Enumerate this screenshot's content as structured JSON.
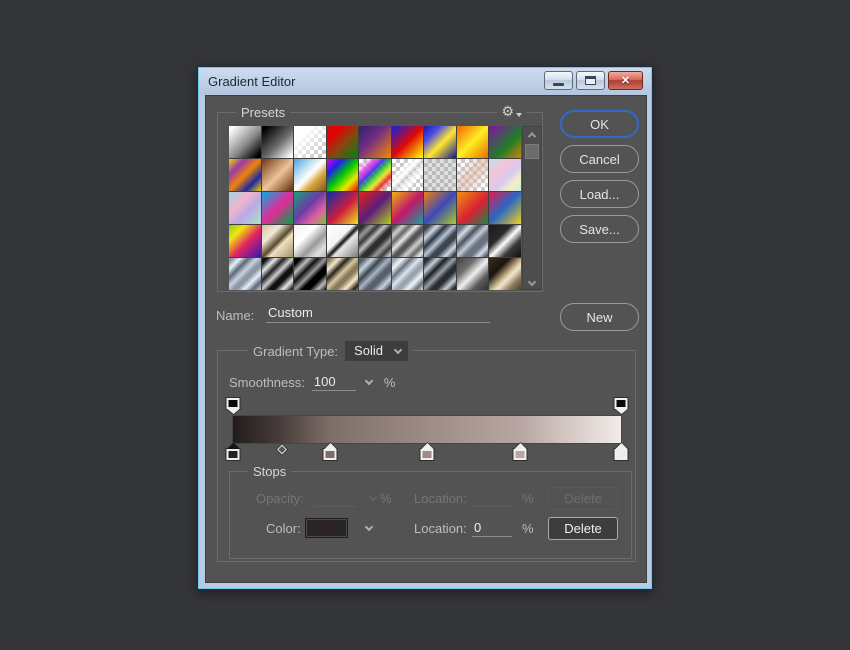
{
  "window": {
    "title": "Gradient Editor"
  },
  "buttons": {
    "ok": "OK",
    "cancel": "Cancel",
    "load": "Load...",
    "save": "Save...",
    "new": "New"
  },
  "presets": {
    "legend": "Presets",
    "menu_icon": "⚙",
    "tiles": [
      {
        "name": "white-to-black",
        "css": "linear-gradient(135deg,#ffffff 8%,#8a8a8a 55%,#000000 92%)"
      },
      {
        "name": "black-to-white",
        "css": "linear-gradient(135deg,#000000 8%,#6a6a6a 55%,#ffffff 95%)"
      },
      {
        "name": "white-to-transparent",
        "css": "linear-gradient(135deg,#ffffff 25%,rgba(255,255,255,0) 85%),conic-gradient(#c9c9c9 25%,#ffffff 25% 50%,#c9c9c9 50% 75%,#ffffff 75%) 0 0/8px 8px"
      },
      {
        "name": "red-to-green",
        "css": "linear-gradient(135deg,#dd0404 25%,#8a4510 55%,#137a10 92%)"
      },
      {
        "name": "violet-to-orange",
        "css": "linear-gradient(135deg,#38276e 8%,#6f2a85 40%,#ea830b 95%)"
      },
      {
        "name": "blue-red-yellow",
        "css": "linear-gradient(135deg,#2222cc 5%,#e00606 50%,#ffee00 95%)"
      },
      {
        "name": "blue-yellow-blue",
        "css": "linear-gradient(135deg,#1a1aa8 0%,#4a4ae8 25%,#ffe92b 55%,#14149a 100%)"
      },
      {
        "name": "orange-yellow-orange",
        "css": "linear-gradient(135deg,#f57905 8%,#ffee22 50%,#ee7702 95%)"
      },
      {
        "name": "purple-green-orange",
        "css": "linear-gradient(135deg,#7a1b9a 5%,#1e7d26 60%,#e8820a 105%)"
      },
      {
        "name": "yellow-violet-orange-blue",
        "css": "linear-gradient(135deg,#f5d402 0%,#9a3aaa 25%,#ef8209 50%,#1c2aa0 75%,#f5d402 100%)"
      },
      {
        "name": "copper",
        "css": "linear-gradient(135deg,#7a4420 5%,#eec498 52%,#6e3c1c 95%)"
      },
      {
        "name": "chrome-blue-gold",
        "css": "linear-gradient(135deg,#4aa2e0 0%,#cfe6f5 35%,#ffffff 50%,#d8a93e 68%,#7a551a 100%)"
      },
      {
        "name": "spectrum",
        "css": "linear-gradient(135deg,#e402e4 0%,#2020e8 25%,#02c802 50%,#e8e802 75%,#e80202 100%)"
      },
      {
        "name": "transparent-rainbow",
        "css": "linear-gradient(135deg,rgba(255,255,255,0) 12%,rgba(230,40,230,0.85) 28%,rgba(40,40,230,0.85) 40%,rgba(30,200,30,0.85) 52%,rgba(235,235,30,0.85) 64%,rgba(235,30,30,0.85) 76%,rgba(255,255,255,0) 90%),conic-gradient(#c9c9c9 25%,#ffffff 25% 50%,#c9c9c9 50% 75%,#ffffff 75%) 0 0/8px 8px"
      },
      {
        "name": "transparent-stripes",
        "css": "linear-gradient(135deg,rgba(255,255,255,0) 25%,rgba(255,255,255,0.95) 42%,rgba(180,180,180,0.4) 55%,rgba(255,255,255,0.8) 63%,rgba(255,255,255,0) 78%),conic-gradient(#c9c9c9 25%,#ffffff 25% 50%,#c9c9c9 50% 75%,#ffffff 75%) 0 0/8px 8px"
      },
      {
        "name": "transparent",
        "css": "linear-gradient(135deg,rgba(150,150,150,0.3),rgba(150,150,150,0.3)),conic-gradient(#c9c9c9 25%,#ffffff 25% 50%,#c9c9c9 50% 75%,#ffffff 75%) 0 0/8px 8px"
      },
      {
        "name": "transparent-rose",
        "css": "linear-gradient(135deg,rgba(255,255,255,0) 15%,rgba(219,173,160,0.6) 50%,rgba(255,255,255,0.1) 85%),conic-gradient(#c9c9c9 25%,#ffffff 25% 50%,#c9c9c9 50% 75%,#ffffff 75%) 0 0/8px 8px"
      },
      {
        "name": "pastel-soft",
        "css": "linear-gradient(135deg,#bfe3ef 0%,#f3c4d6 32%,#d9c9ef 58%,#f5efc9 78%,#c9efd9 100%)"
      },
      {
        "name": "pastel-rainbow",
        "css": "linear-gradient(135deg,#9fd4ea 0%,#f0b4cc 35%,#b9a9e6 60%,#abe6c4 100%)"
      },
      {
        "name": "cyan-magenta-green",
        "css": "linear-gradient(135deg,#19a2d8 5%,#e42a9a 50%,#13984a 95%)"
      },
      {
        "name": "teal-purple-pink-green",
        "css": "linear-gradient(135deg,#16a17e 0%,#6d3ba4 45%,#e060a8 72%,#7fc22f 100%)"
      },
      {
        "name": "blue-red-yellow-2",
        "css": "linear-gradient(135deg,#1c2ba3 5%,#cf1f3e 55%,#efe71c 100%)"
      },
      {
        "name": "red-violet-lime",
        "css": "linear-gradient(135deg,#d92121 5%,#5c1d79 50%,#b2cf1d 100%)"
      },
      {
        "name": "gold-magenta-teal",
        "css": "linear-gradient(135deg,#efb211 0%,#c0186a 50%,#14a39a 100%)"
      },
      {
        "name": "orange-blue-lime",
        "css": "linear-gradient(135deg,#ef8111 0%,#3c4ab8 50%,#aacc22 100%)"
      },
      {
        "name": "orange-red-green",
        "css": "linear-gradient(135deg,#ef9211 0%,#d92134 55%,#168a4a 100%)"
      },
      {
        "name": "red-blue-yellow",
        "css": "linear-gradient(135deg,#e31b4e 0%,#2a66c4 48%,#efd31c 100%)"
      },
      {
        "name": "lime-yellow-red-violet",
        "css": "linear-gradient(135deg,#8fc812 0%,#efe712 25%,#e3265c 55%,#7a1b9a 82%,#3a1b9a 100%)"
      },
      {
        "name": "sandstone-metal",
        "css": "linear-gradient(135deg,#cfc0a5 0%,#f2ead8 30%,#564729 52%,#efe2c4 62%,#a39066 100%)"
      },
      {
        "name": "silver",
        "css": "linear-gradient(135deg,#efefef 0%,#ffffff 35%,#9a9a9a 62%,#e0e0e0 82%,#b5b5b5 100%)"
      },
      {
        "name": "chrome",
        "css": "linear-gradient(135deg,#ffffff 0%,#f5f5f5 42%,#111111 52%,#e8e8e8 60%,#7a7a7a 100%)"
      },
      {
        "name": "dark-metal",
        "css": "repeating-linear-gradient(135deg,#2e2e2e 0 4px,#9a9a9a 9px,#3a3a3a 14px,#c0c0c0 19px,#2e2e2e 24px)"
      },
      {
        "name": "steel-gray",
        "css": "repeating-linear-gradient(135deg,#555555 0 3px,#cfcfcf 8px,#666666 13px,#e8e8e8 18px,#555555 23px)"
      },
      {
        "name": "steel-blue-dark",
        "css": "repeating-linear-gradient(135deg,#3c4450 0 4px,#cfd9e6 10px,#2e3642 16px,#b8c4d4 22px,#3c4450 27px)"
      },
      {
        "name": "steel-blue",
        "css": "repeating-linear-gradient(135deg,#6a7280 0 5px,#d4dce8 10px,#4a525e 16px,#c4ccd8 22px,#6a7280 27px)"
      },
      {
        "name": "black-white-band",
        "css": "linear-gradient(135deg,#1a1a1a 0%,#2a2a2a 35%,#ffffff 52%,#3a3a3a 72%,#111111 100%)"
      },
      {
        "name": "blue-chrome",
        "css": "repeating-linear-gradient(135deg,#8a98a8 0 3px,#e8f0f8 8px,#5a6878 14px,#c8d4e0 20px,#8a98a8 25px)"
      },
      {
        "name": "bw-chrome",
        "css": "repeating-linear-gradient(135deg,#111111 0 4px,#e8e8e8 10px,#222222 16px,#cfcfcf 22px,#111111 27px)"
      },
      {
        "name": "black-silver",
        "css": "repeating-linear-gradient(135deg,#000000 0 5px,#bbbbbb 11px,#111111 17px,#999999 23px,#000000 28px)"
      },
      {
        "name": "brass-chrome",
        "css": "repeating-linear-gradient(135deg,#8a7a5a 0 3px,#f5ead0 9px,#2a2418 15px,#d8c8a0 21px,#8a7a5a 26px)"
      },
      {
        "name": "slate-chrome",
        "css": "repeating-linear-gradient(135deg,#55606c 0 4px,#c8d2de 10px,#3c4450 16px,#a8b4c2 22px,#55606c 27px)"
      },
      {
        "name": "silver-blue-stripes",
        "css": "repeating-linear-gradient(135deg,#9aa4b0 0 3px,#f2f6fa 8px,#6a7480 14px,#dce4ec 20px,#9aa4b0 25px)"
      },
      {
        "name": "dark-silver-stripes",
        "css": "repeating-linear-gradient(135deg,#2a2e34 0 4px,#c8ccd4 10px,#1a1e24 16px,#9aa0a8 22px,#2a2e34 27px)"
      },
      {
        "name": "gray-white-stripes",
        "css": "linear-gradient(135deg,#444444 0%,#6e6e6e 30%,#f0f0f0 52%,#5a5a5a 75%,#303030 100%)"
      },
      {
        "name": "bronze-dark",
        "css": "linear-gradient(135deg,#3a2e1e 0%,#1a140a 32%,#d8c49a 55%,#f0e8d0 62%,#8a7a5a 80%,#4a3e28 100%)"
      }
    ]
  },
  "name_row": {
    "label": "Name:",
    "value": "Custom"
  },
  "gradient_type": {
    "label": "Gradient Type:",
    "value": "Solid"
  },
  "smoothness": {
    "label": "Smoothness:",
    "value": "100",
    "unit": "%"
  },
  "gradient_bar": {
    "css": "linear-gradient(90deg,#221c1c 0%,#473c3a 12%,#7e6e68 25%,#9d8b87 50%,#b8a6a3 74%,#f3ece9 100%)",
    "opacity_stops": [
      {
        "location": 0,
        "opacity": 100
      },
      {
        "location": 100,
        "opacity": 100
      }
    ],
    "color_stops": [
      {
        "location": 0,
        "color": "#262020",
        "selected": true
      },
      {
        "location": 25,
        "color": "#7e6e68",
        "selected": false
      },
      {
        "location": 50,
        "color": "#9d8b87",
        "selected": false
      },
      {
        "location": 74,
        "color": "#b8a6a3",
        "selected": false
      },
      {
        "location": 100,
        "color": "#f3ece9",
        "selected": false
      }
    ],
    "midpoints": [
      12.5
    ]
  },
  "stops": {
    "legend": "Stops",
    "opacity_row": {
      "label": "Opacity:",
      "value": "",
      "unit": "%",
      "location_label": "Location:",
      "location_value": "",
      "location_unit": "%",
      "delete_label": "Delete",
      "enabled": false
    },
    "color_row": {
      "label": "Color:",
      "swatch_color": "#2a2424",
      "location_label": "Location:",
      "location_value": "0",
      "location_unit": "%",
      "delete_label": "Delete",
      "enabled": true
    }
  },
  "colors": {
    "page_bg": "#343539",
    "panel_bg": "#535353",
    "frame": "#b9cbe4",
    "frame_accent": "#62c9e9",
    "ok_border": "#2f6bc9",
    "button_border": "#9a9a9a",
    "groupbox_border": "#6b6b6b",
    "label": "#bdbdbd",
    "value_text": "#ececec",
    "disabled_text": "#757575",
    "close_red": "#bd4437"
  }
}
